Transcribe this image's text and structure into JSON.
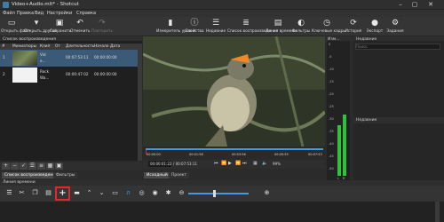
{
  "window": {
    "title": "Video+Audio.mlt* - Shotcut"
  },
  "menu": [
    "Файл",
    "Правка",
    "Вид",
    "Настройки",
    "Справка"
  ],
  "toolbar": [
    {
      "label": "Открыть файл",
      "icon": "folder-icon",
      "glyph": "▭",
      "enabled": true
    },
    {
      "label": "Открыть другой",
      "icon": "open-other-icon",
      "glyph": "▾",
      "enabled": true
    },
    {
      "label": "Сохранить",
      "icon": "save-icon",
      "glyph": "▣",
      "enabled": true
    },
    {
      "label": "Отменить",
      "icon": "undo-icon",
      "glyph": "↶",
      "enabled": true
    },
    {
      "label": "Повторить",
      "icon": "redo-icon",
      "glyph": "↷",
      "enabled": false
    },
    {
      "label": "Измеритель уровня",
      "icon": "meter-icon",
      "glyph": "▮",
      "enabled": true
    },
    {
      "label": "Свойства",
      "icon": "properties-icon",
      "glyph": "ⓘ",
      "enabled": true
    },
    {
      "label": "Недавние",
      "icon": "recent-icon",
      "glyph": "☰",
      "enabled": true
    },
    {
      "label": "Список воспроизведения",
      "icon": "playlist-icon",
      "glyph": "≣",
      "enabled": true
    },
    {
      "label": "Линия времени",
      "icon": "timeline-icon",
      "glyph": "▤",
      "enabled": true
    },
    {
      "label": "Фильтры",
      "icon": "filters-icon",
      "glyph": "◐",
      "enabled": true
    },
    {
      "label": "Ключевые кадры",
      "icon": "keyframes-icon",
      "glyph": "◷",
      "enabled": true
    },
    {
      "label": "История",
      "icon": "history-icon",
      "glyph": "⟳",
      "enabled": true
    },
    {
      "label": "Экспорт",
      "icon": "export-icon",
      "glyph": "●",
      "enabled": true
    },
    {
      "label": "Задания",
      "icon": "jobs-icon",
      "glyph": "⚙",
      "enabled": true
    }
  ],
  "playlist": {
    "title": "Список воспроизведения",
    "columns": [
      "#",
      "Миниатюры",
      "Клип",
      "От",
      "Длительность",
      "Начало",
      "Дата"
    ],
    "rows": [
      {
        "num": "1",
        "clip_line1": "Vid",
        "clip_line2": "e...",
        "duration": "00:07:53:11",
        "start": "00:00:00:00"
      },
      {
        "num": "2",
        "clip_line1": "Rock",
        "clip_line2": "Wa...",
        "duration": "00:00:47:02",
        "start": "00:00:00:00"
      }
    ],
    "tabs": [
      "Список воспроизведения",
      "Фильтры"
    ]
  },
  "player": {
    "ruler": [
      "00:00:00",
      "00:01:58",
      "00:03:56",
      "00:05:55",
      "00:07:53"
    ],
    "current_time": "00:00:01:22",
    "total_time": "/ 00:07:53:11",
    "zoom": "99%",
    "tabs": [
      "Исходный",
      "Проект"
    ]
  },
  "meter": {
    "title": "Изм...",
    "scale": [
      "0",
      "-5",
      "-10",
      "-15",
      "-20",
      "-25",
      "-30",
      "-35",
      "-40",
      "-45",
      "-50"
    ],
    "levels": [
      0.38,
      0.46
    ],
    "channels": [
      "L",
      "R"
    ]
  },
  "properties": {
    "title": "Недавние",
    "search_placeholder": "Поиск"
  },
  "history": {
    "title": "Недавние"
  },
  "timeline": {
    "title": "Линия времени"
  },
  "colors": {
    "highlight": "#e02828",
    "accent": "#3d9ae8",
    "meter": "#2ec23a"
  }
}
